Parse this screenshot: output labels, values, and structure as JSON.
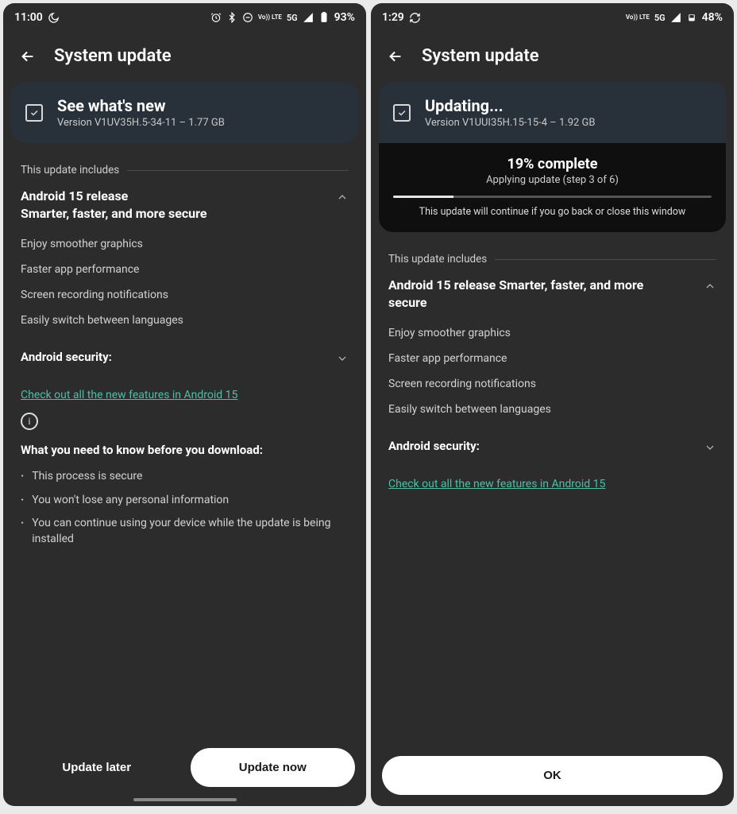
{
  "left": {
    "status": {
      "time": "11:00",
      "network": "5G",
      "lte": "Vo)) LTE",
      "battery": "93%"
    },
    "header": {
      "title": "System update"
    },
    "card": {
      "title": "See what's new",
      "subtitle": "Version V1UV35H.5-34-11 – 1.77 GB"
    },
    "includes_label": "This update includes",
    "release": {
      "title": "Android 15 release\nSmarter, faster, and more secure",
      "features": [
        "Enjoy smoother graphics",
        "Faster app performance",
        "Screen recording notifications",
        "Easily switch between languages"
      ]
    },
    "security_label": "Android security:",
    "link": "Check out all the new features in Android 15",
    "know": {
      "title": "What you need to know before you download:",
      "items": [
        "This process is secure",
        "You won't lose any personal information",
        "You can continue using your device while the update is being installed"
      ]
    },
    "buttons": {
      "later": "Update later",
      "now": "Update now"
    }
  },
  "right": {
    "status": {
      "time": "1:29",
      "network": "5G",
      "lte": "Vo)) LTE",
      "battery": "48%"
    },
    "header": {
      "title": "System update"
    },
    "card": {
      "title": "Updating...",
      "subtitle": "Version V1UUI35H.15-15-4 – 1.92 GB"
    },
    "progress": {
      "title": "19% complete",
      "subtitle": "Applying update (step 3 of 6)",
      "percent": 19,
      "note": "This update will continue if you go back or close this window"
    },
    "includes_label": "This update includes",
    "release": {
      "title": "Android 15 release Smarter, faster, and more secure",
      "features": [
        "Enjoy smoother graphics",
        "Faster app performance",
        "Screen recording notifications",
        "Easily switch between languages"
      ]
    },
    "security_label": "Android security:",
    "link": "Check out all the new features in Android 15",
    "buttons": {
      "ok": "OK"
    }
  }
}
